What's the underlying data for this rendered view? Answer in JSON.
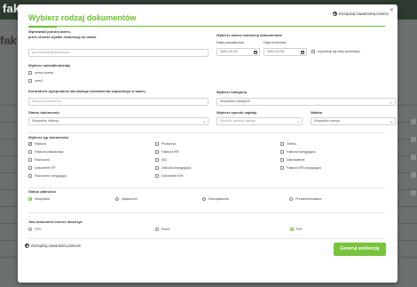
{
  "background": {
    "logo": "faktu",
    "page_title": "faktu"
  },
  "modal": {
    "title": "Wybierz rodzaj dokumentów",
    "manage_columns_label": "Zarządzaj zawartością kolumn",
    "close_icon": "close-icon",
    "email_label_line1": "Wprowadź poniżej adres,",
    "email_label_line2": "jeżeli chcesz wysłać ewidencję na maila.",
    "email_placeholder": "jan.kowalski@nfaktura.pl",
    "date_range_label": "Wybierz zakres ewidencji dokumentów",
    "date_from_label": "Data początkowa",
    "date_to_label": "Data końcowa",
    "date_from": "2021-10-10",
    "date_to": "2021-12-09",
    "search_by_sale_date_label": "wyszukaj wg daty sprzedaży",
    "branches_label": "Wybierz oddział/oddziały",
    "branches": [
      "nowa nazwa",
      "num2"
    ],
    "contractor_label": "Kontrahent (opcjonalnie dla danego kontrahenta zapisanego w bazie)",
    "contractor_placeholder": "Nazwa kontrahenta",
    "category_label": "Wybierz kategorię",
    "category_value": "Wszystkie kategorie",
    "doc_status_label": "Status dokumentu",
    "doc_status_value": "Wszystkie statusy",
    "payment_method_label": "Wybierz sposób zapłaty",
    "payment_method_value": "Wybierz sposób zapłaty",
    "currency_label": "Waluta",
    "currency_value": "Wszystkie waluty",
    "doc_type_label": "Wybierz typ dokumentu",
    "doc_types": [
      {
        "label": "Faktura",
        "checked": true
      },
      {
        "label": "Proforma",
        "checked": false
      },
      {
        "label": "Oferta",
        "checked": false
      },
      {
        "label": "Faktura zaliczkowa",
        "checked": false
      },
      {
        "label": "Faktura RR",
        "checked": false
      },
      {
        "label": "Faktura korygująca",
        "checked": false
      },
      {
        "label": "Rachunek",
        "checked": false
      },
      {
        "label": "WZ",
        "checked": false
      },
      {
        "label": "Zamówienie",
        "checked": false
      },
      {
        "label": "Dokument KP",
        "checked": false
      },
      {
        "label": "Zaliczka korygująca",
        "checked": false
      },
      {
        "label": "Faktura RR korygująca",
        "checked": false
      },
      {
        "label": "Rachunek korygujący",
        "checked": false
      },
      {
        "label": "Dokument KW",
        "checked": false
      }
    ],
    "payment_status_label": "Status płatności",
    "payment_statuses": [
      {
        "label": "Wszystkie",
        "selected": true
      },
      {
        "label": "Zapłacone",
        "selected": false
      },
      {
        "label": "Niezapłacone",
        "selected": false
      },
      {
        "label": "Przeterminowane",
        "selected": false
      }
    ],
    "format_label": "Jaki dokument chcesz utworzyć",
    "formats": [
      {
        "label": "CSV",
        "selected": false
      },
      {
        "label": "Excel",
        "selected": false
      },
      {
        "label": "Pdf",
        "selected": true
      }
    ],
    "generate_button": "Generuj ewidencję",
    "accent_color": "#6abf2e"
  }
}
